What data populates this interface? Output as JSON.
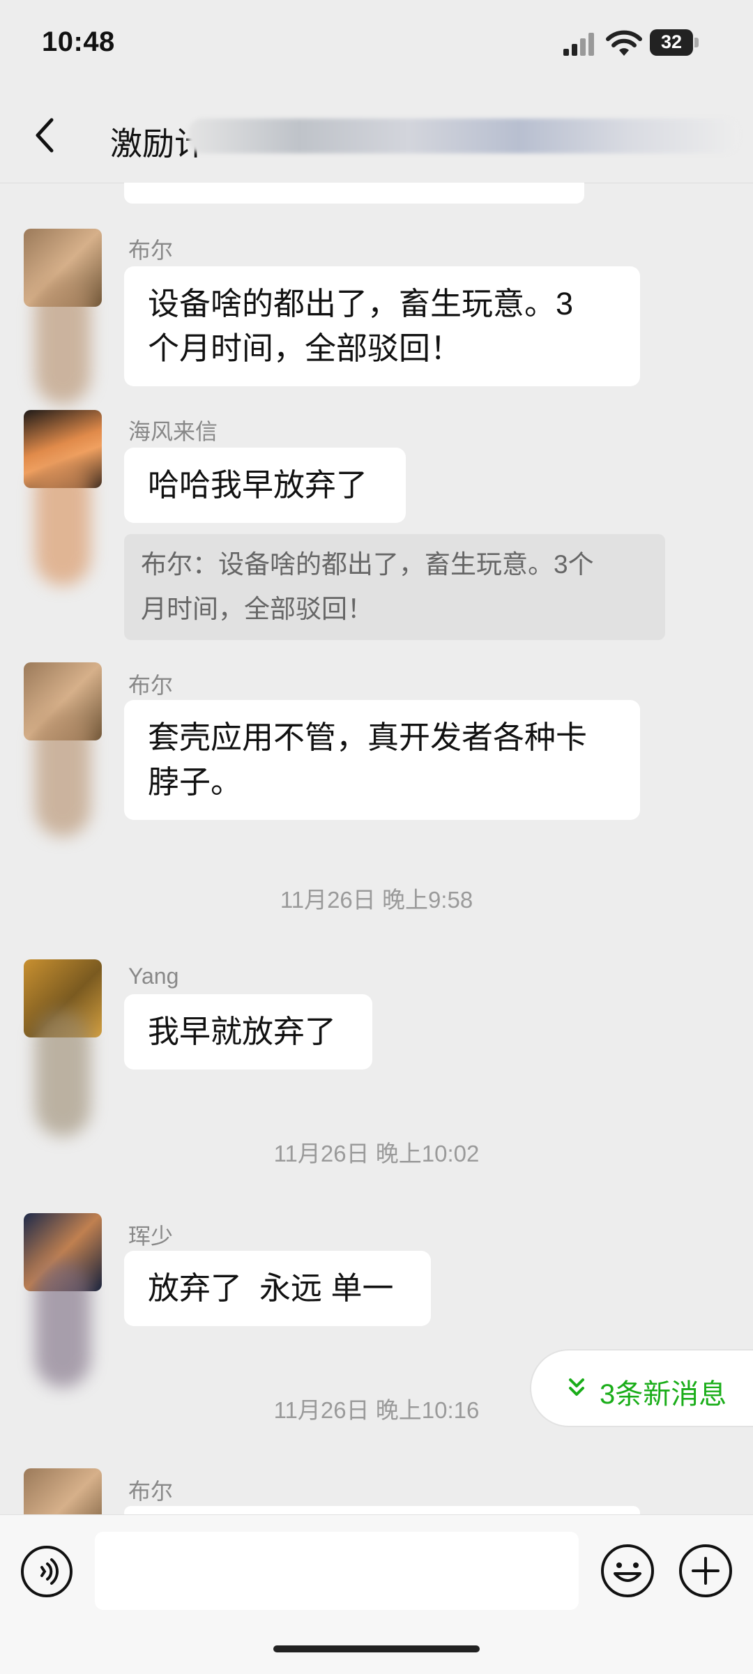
{
  "status_bar": {
    "time": "10:48",
    "battery": "32"
  },
  "header": {
    "title": "激励计"
  },
  "messages": [
    {
      "sender": "布尔",
      "text_lines": [
        "设备啥的都出了，畜生玩意。3",
        "个月时间，全部驳回！"
      ]
    },
    {
      "sender": "海风来信",
      "text": "哈哈我早放弃了",
      "quote_lines": [
        "布尔：设备啥的都出了，畜生玩意。3个",
        "月时间，全部驳回！"
      ]
    },
    {
      "sender": "布尔",
      "text_lines": [
        "套壳应用不管，真开发者各种卡",
        "脖子。"
      ]
    },
    {
      "sender": "Yang",
      "text": "我早就放弃了"
    },
    {
      "sender": "珲少",
      "text": "放弃了  永远 单一"
    },
    {
      "sender": "布尔"
    }
  ],
  "timestamps": [
    "11月26日 晚上9:58",
    "11月26日 晚上10:02",
    "11月26日 晚上10:16"
  ],
  "new_messages": {
    "label": "3条新消息"
  },
  "colors": {
    "accent": "#1aad19",
    "background": "#ededed",
    "bubble": "#ffffff",
    "quote": "#e1e1e1"
  }
}
